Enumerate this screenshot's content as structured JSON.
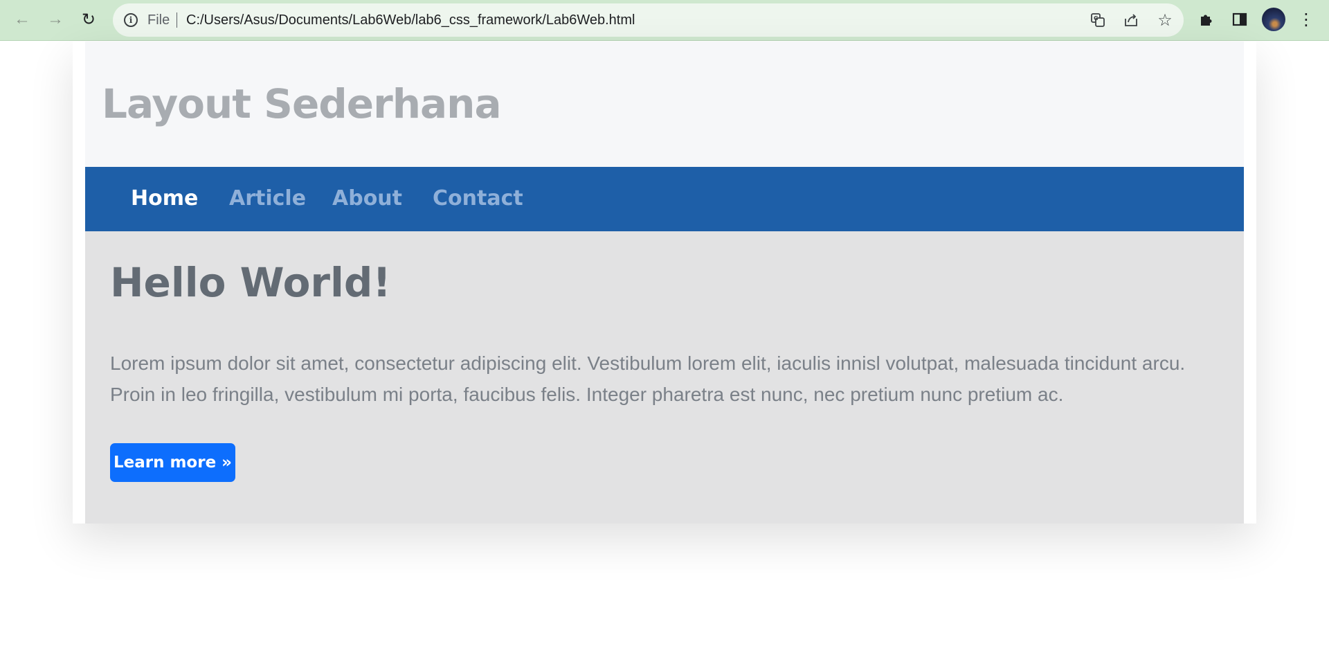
{
  "browser": {
    "back_icon": "←",
    "forward_icon": "→",
    "reload_icon": "↻",
    "info_icon": "i",
    "scheme_label": "File",
    "url": "C:/Users/Asus/Documents/Lab6Web/lab6_css_framework/Lab6Web.html",
    "translate_icon": "⧉",
    "share_icon": "⇪",
    "bookmark_icon": "☆",
    "extensions_icon": "✚",
    "side_panel_icon": "▮",
    "menu_icon": "⋮"
  },
  "header": {
    "title": "Layout Sederhana"
  },
  "nav": {
    "items": [
      {
        "label": "Home",
        "active": true
      },
      {
        "label": "Article",
        "active": false
      },
      {
        "label": "About",
        "active": false
      },
      {
        "label": "Contact",
        "active": false
      }
    ]
  },
  "hero": {
    "title": "Hello World!",
    "text": "Lorem ipsum dolor sit amet, consectetur adipiscing elit. Vestibulum lorem elit, iaculis innisl volutpat, malesuada tincidunt arcu. Proin in leo fringilla, vestibulum mi porta, faucibus felis. Integer pharetra est nunc, nec pretium nunc pretium ac.",
    "button_label": "Learn more »"
  },
  "colors": {
    "chrome_bg": "#cfe8cf",
    "navbar_bg": "#1e5fa8",
    "button_bg": "#0d6efd",
    "jumbotron_bg": "#e2e2e3"
  }
}
